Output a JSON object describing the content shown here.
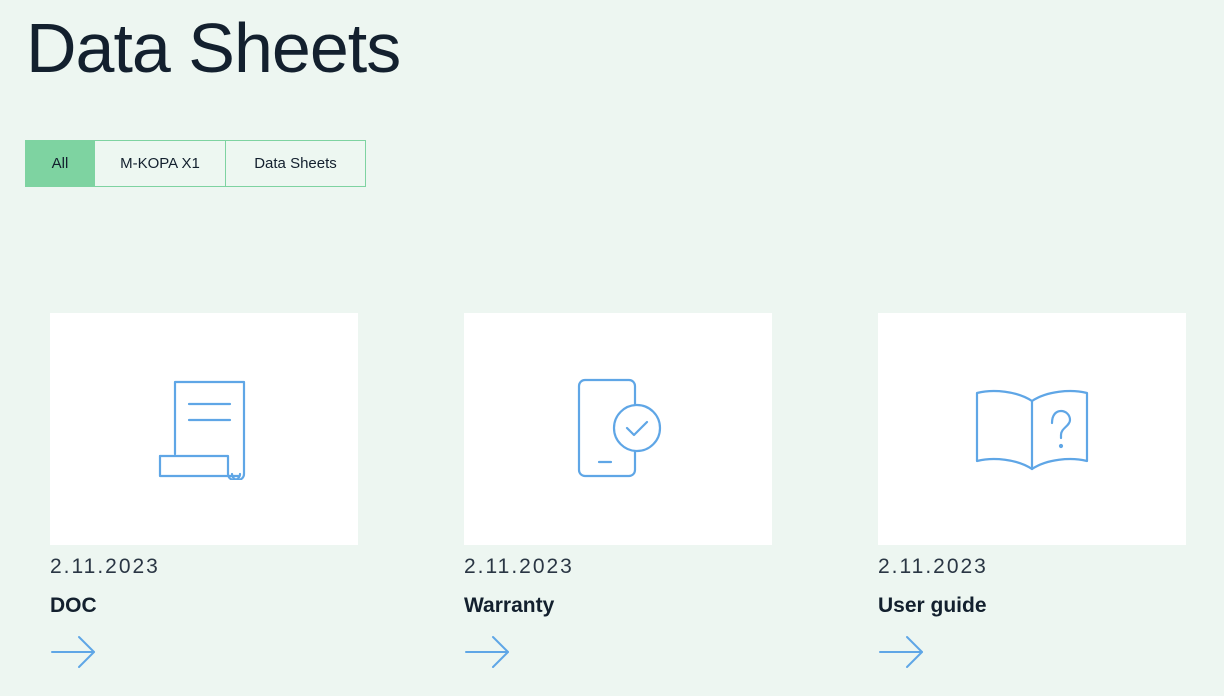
{
  "page": {
    "title": "Data Sheets"
  },
  "filters": [
    {
      "label": "All",
      "active": true
    },
    {
      "label": "M-KOPA X1",
      "active": false
    },
    {
      "label": "Data Sheets",
      "active": false
    }
  ],
  "cards": [
    {
      "date": "2.11.2023",
      "title": "DOC",
      "icon": "document-scroll-icon"
    },
    {
      "date": "2.11.2023",
      "title": "Warranty",
      "icon": "phone-check-icon"
    },
    {
      "date": "2.11.2023",
      "title": "User guide",
      "icon": "book-question-icon"
    }
  ],
  "colors": {
    "background": "#edf6f1",
    "accent_green": "#7ed3a1",
    "icon_blue": "#5fa6e6",
    "text_dark": "#13202e"
  }
}
